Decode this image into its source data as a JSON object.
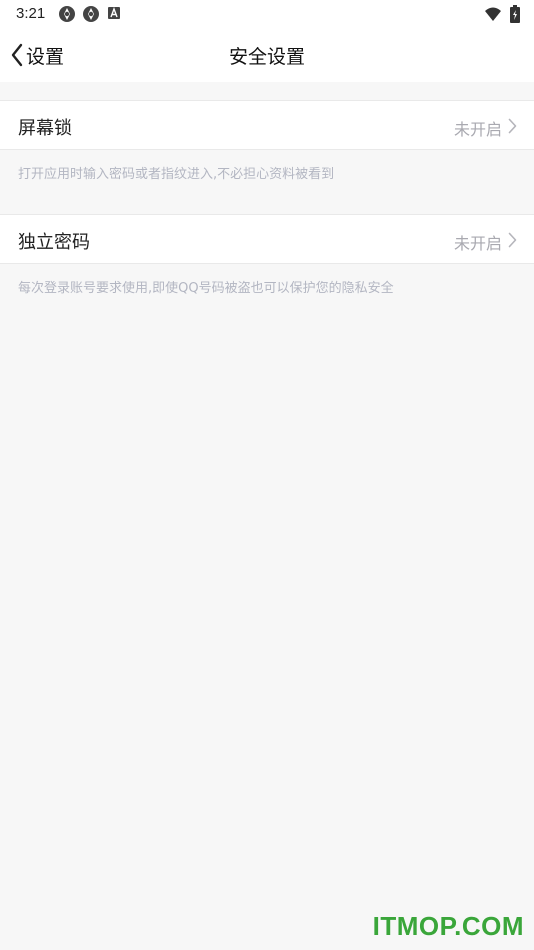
{
  "status_bar": {
    "time": "3:21",
    "left_icons": [
      "aperture-icon",
      "aperture-icon",
      "a-badge-icon"
    ],
    "right_icons": [
      "wifi-icon",
      "battery-charging-icon"
    ]
  },
  "nav": {
    "back_label": "设置",
    "title": "安全设置"
  },
  "settings": [
    {
      "label": "屏幕锁",
      "value": "未开启",
      "description": "打开应用时输入密码或者指纹进入,不必担心资料被看到"
    },
    {
      "label": "独立密码",
      "value": "未开启",
      "description": "每次登录账号要求使用,即使QQ号码被盗也可以保护您的隐私安全"
    }
  ],
  "watermark": "ITMOP.COM",
  "colors": {
    "background": "#f7f7f7",
    "row_background": "#ffffff",
    "value_text": "#a9a9b0",
    "description_text": "#b3b6c2",
    "watermark": "#3aa63a"
  }
}
